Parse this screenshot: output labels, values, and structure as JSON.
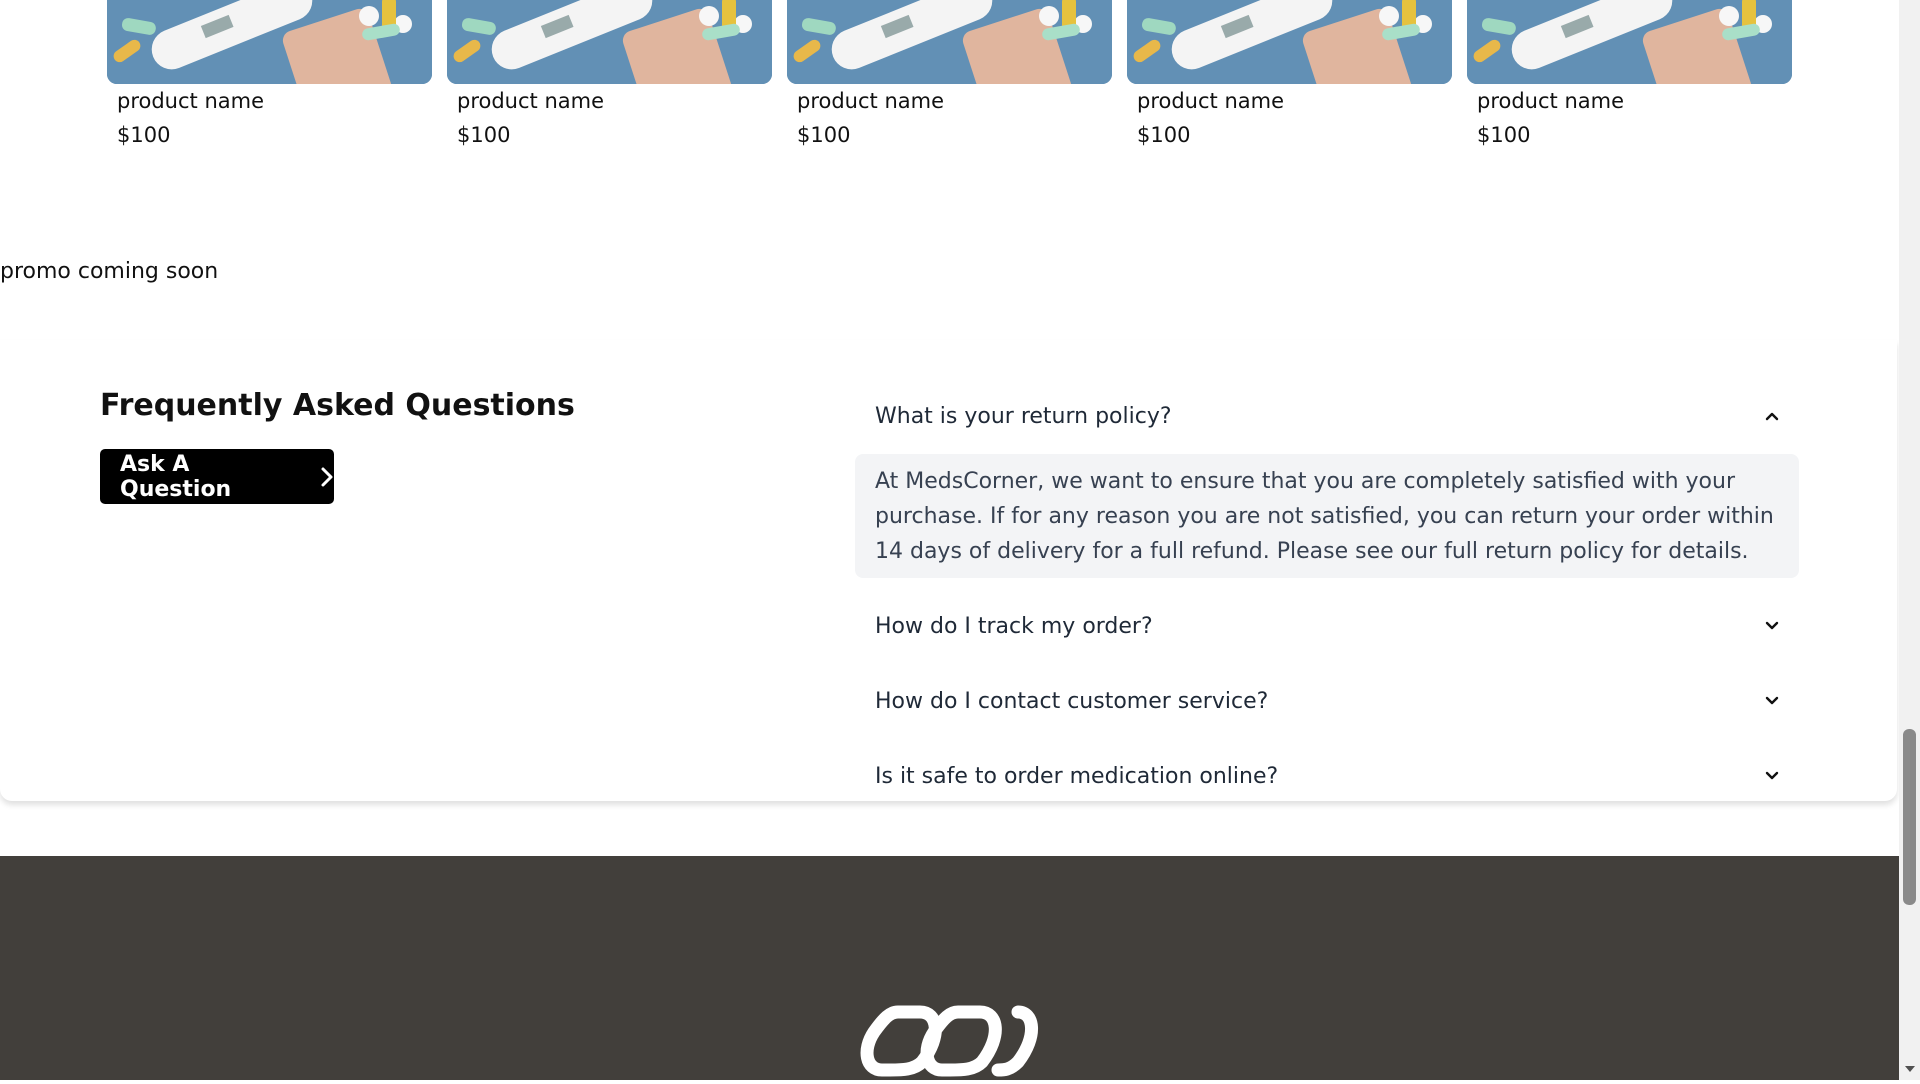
{
  "products": [
    {
      "name": "product name",
      "price": "$100"
    },
    {
      "name": "product name",
      "price": "$100"
    },
    {
      "name": "product name",
      "price": "$100"
    },
    {
      "name": "product name",
      "price": "$100"
    },
    {
      "name": "product name",
      "price": "$100"
    }
  ],
  "promo": {
    "text": "promo coming soon"
  },
  "faq": {
    "title": "Frequently Asked Questions",
    "ask_button": "Ask A Question",
    "items": [
      {
        "question": "What is your return policy?",
        "expanded": true,
        "answer": "At MedsCorner, we want to ensure that you are completely satisfied with your purchase. If for any reason you are not satisfied, you can return your order within 14 days of delivery for a full refund. Please see our full return policy for details."
      },
      {
        "question": "How do I track my order?",
        "expanded": false
      },
      {
        "question": "How do I contact customer service?",
        "expanded": false
      },
      {
        "question": "Is it safe to order medication online?",
        "expanded": false
      }
    ]
  },
  "colors": {
    "footer_bg": "#423f3b",
    "button_bg": "#000000",
    "answer_bg": "#f3f4f6"
  },
  "icons": {
    "product_image": "medical-supplies-image",
    "faq_toggle_open": "chevron-up-icon",
    "faq_toggle_closed": "chevron-down-icon",
    "ask_button": "chevron-right-icon",
    "footer_logo": "linked-loops-logo"
  }
}
